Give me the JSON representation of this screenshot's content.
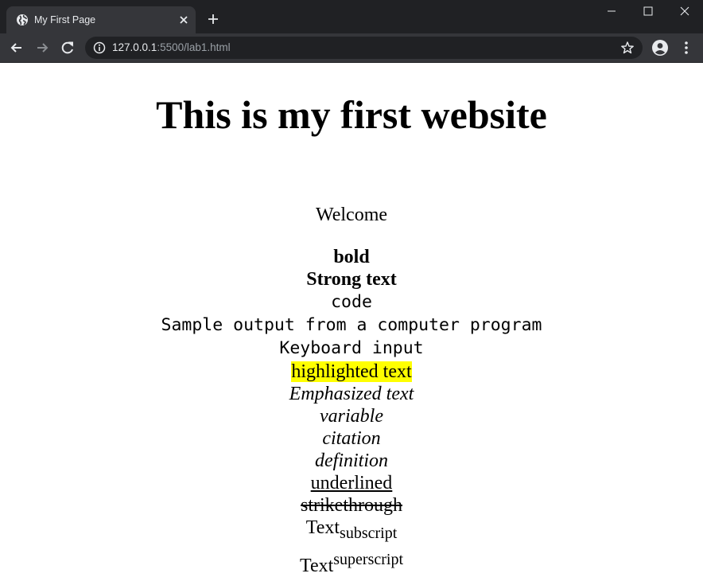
{
  "browser": {
    "tab_title": "My First Page",
    "url_host": "127.0.0.1",
    "url_path": ":5500/lab1.html"
  },
  "page": {
    "heading": "This is my first website",
    "welcome": "Welcome",
    "bold": "bold",
    "strong": "Strong text",
    "code": "code",
    "samp": "Sample output from a computer program",
    "kbd": "Keyboard input",
    "mark": "highlighted text",
    "em": "Emphasized text",
    "var": "variable",
    "cite": "citation",
    "dfn": "definition",
    "underline": "underlined",
    "strike": "strikethrough",
    "sub_base": "Text",
    "sub": "subscript",
    "sup_base": "Text",
    "sup": "superscript"
  },
  "colors": {
    "highlight": "#ffff00",
    "titlebar": "#202124",
    "toolbar": "#35363a"
  },
  "icons": [
    "globe-icon",
    "close-icon",
    "plus-icon",
    "minimize-icon",
    "maximize-icon",
    "window-close-icon",
    "back-arrow-icon",
    "forward-arrow-icon",
    "reload-icon",
    "info-icon",
    "star-icon",
    "profile-icon",
    "menu-icon"
  ]
}
